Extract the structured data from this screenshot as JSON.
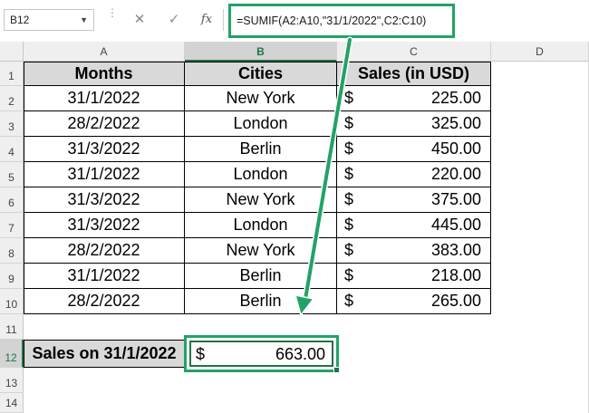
{
  "namebox": {
    "value": "B12"
  },
  "formula_bar": {
    "cancel_icon": "✕",
    "enter_icon": "✓",
    "fx_label": "fx",
    "formula": "=SUMIF(A2:A10,\"31/1/2022\",C2:C10)"
  },
  "columns": [
    "A",
    "B",
    "C",
    "D"
  ],
  "rows": [
    "1",
    "2",
    "3",
    "4",
    "5",
    "6",
    "7",
    "8",
    "9",
    "10",
    "11",
    "12",
    "13",
    "14"
  ],
  "table": {
    "headers": [
      "Months",
      "Cities",
      "Sales (in USD)"
    ],
    "records": [
      {
        "month": "31/1/2022",
        "city": "New York",
        "currency": "$",
        "sales": "225.00"
      },
      {
        "month": "28/2/2022",
        "city": "London",
        "currency": "$",
        "sales": "325.00"
      },
      {
        "month": "31/3/2022",
        "city": "Berlin",
        "currency": "$",
        "sales": "450.00"
      },
      {
        "month": "31/1/2022",
        "city": "London",
        "currency": "$",
        "sales": "220.00"
      },
      {
        "month": "31/3/2022",
        "city": "New York",
        "currency": "$",
        "sales": "375.00"
      },
      {
        "month": "31/3/2022",
        "city": "London",
        "currency": "$",
        "sales": "445.00"
      },
      {
        "month": "28/2/2022",
        "city": "New York",
        "currency": "$",
        "sales": "383.00"
      },
      {
        "month": "31/1/2022",
        "city": "Berlin",
        "currency": "$",
        "sales": "218.00"
      },
      {
        "month": "28/2/2022",
        "city": "Berlin",
        "currency": "$",
        "sales": "265.00"
      }
    ]
  },
  "result": {
    "label": "Sales on 31/1/2022",
    "currency": "$",
    "value": "663.00"
  },
  "colors": {
    "highlight": "#21a366",
    "selection": "#217346",
    "header_fill": "#d9d9d9"
  }
}
